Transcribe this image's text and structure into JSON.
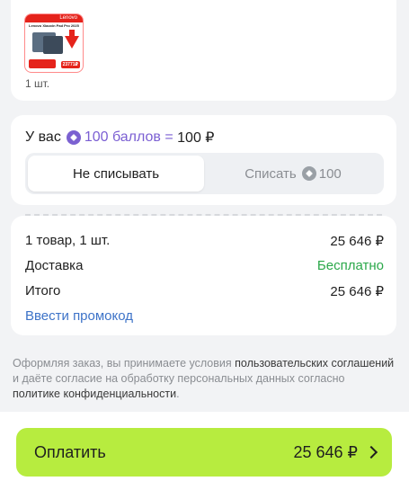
{
  "product": {
    "thumb_brand": "Lenovo",
    "thumb_title": "Lenovo Xiaoxin Pad Pro 2025",
    "thumb_price": "23771₽",
    "quantity_label": "1 шт."
  },
  "points": {
    "prefix": "У вас",
    "amount_label": "100 баллов",
    "equals": "= 100 ₽",
    "option_keep": "Не списывать",
    "option_spend_label": "Списать",
    "option_spend_value": "100"
  },
  "summary": {
    "items_label": "1 товар, 1 шт.",
    "items_value": "25 646 ₽",
    "delivery_label": "Доставка",
    "delivery_value": "Бесплатно",
    "total_label": "Итого",
    "total_value": "25 646 ₽",
    "promo_link": "Ввести промокод"
  },
  "legal": {
    "part1": "Оформляя заказ, вы принимаете условия ",
    "link1": "пользовательских соглашений",
    "part2": " и даёте согласие на обработку персональных данных согласно ",
    "link2": "политике конфиденциальности",
    "part3": "."
  },
  "pay_button": {
    "label": "Оплатить",
    "amount": "25 646 ₽"
  },
  "colors": {
    "accent_green": "#b7ec3f",
    "points_purple": "#7b5fd3",
    "free_green": "#2ba84a",
    "link_blue": "#3d73c8"
  }
}
